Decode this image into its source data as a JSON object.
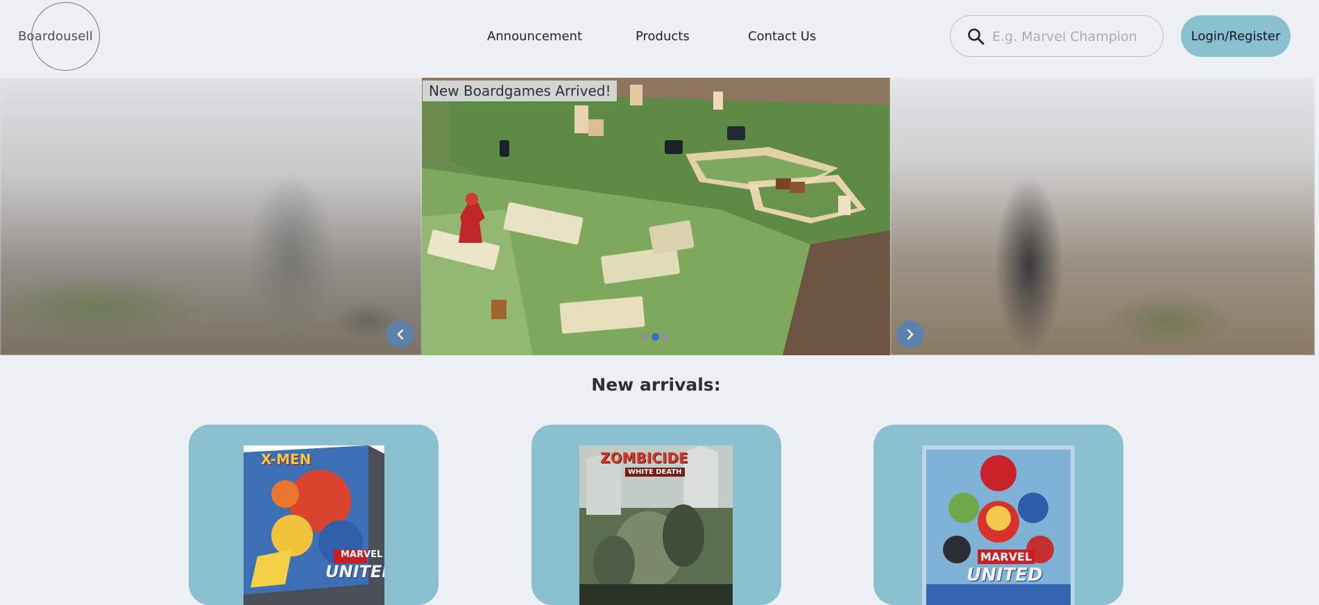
{
  "header": {
    "logo_text": "Boardousell",
    "nav": [
      "Announcement",
      "Products",
      "Contact Us"
    ],
    "search": {
      "placeholder": "E.g. Marvel Champion",
      "value": ""
    },
    "login_label": "Login/Register"
  },
  "carousel": {
    "caption": "New Boardgames Arrived!",
    "slide_count": 3,
    "active_index": 1
  },
  "new_arrivals": {
    "title": "New arrivals:",
    "products": [
      {
        "name": "X-Men Marvel United",
        "cover_top": "X-MEN",
        "cover_bottom": "UNITED",
        "brand": "MARVEL"
      },
      {
        "name": "Zombicide White Death",
        "cover_top": "ZOMBICIDE",
        "cover_bottom": "WHITE DEATH",
        "brand": ""
      },
      {
        "name": "Marvel United",
        "cover_top": "MARVEL",
        "cover_bottom": "UNITED",
        "brand": ""
      }
    ]
  },
  "colors": {
    "background": "#eceff4",
    "accent": "#88c0d0",
    "carousel_arrow": "#5e81ac",
    "dot_active": "#3b6fc4"
  },
  "icons": [
    "search-icon",
    "chevron-left-icon",
    "chevron-right-icon"
  ]
}
